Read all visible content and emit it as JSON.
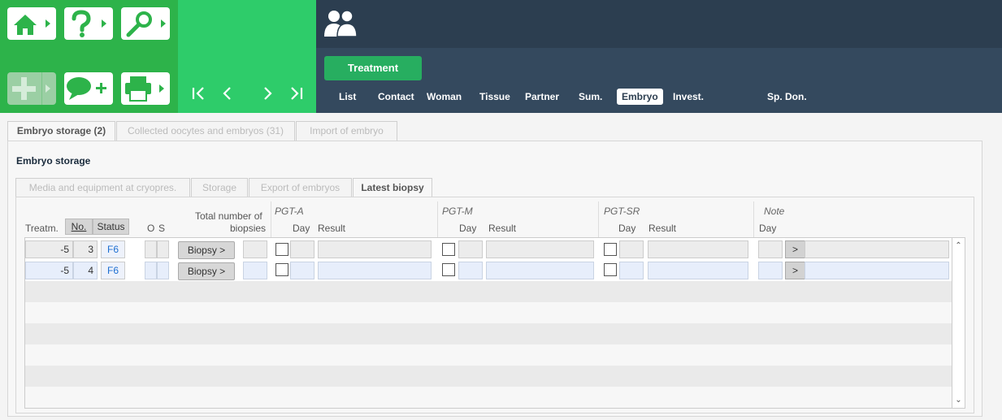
{
  "header": {
    "tools": [
      {
        "name": "home",
        "icon": "home-icon"
      },
      {
        "name": "help",
        "icon": "question-icon"
      },
      {
        "name": "search",
        "icon": "key-search-icon"
      },
      {
        "name": "add",
        "icon": "plus-icon"
      },
      {
        "name": "comment-add",
        "icon": "speech-bubble-plus-icon"
      },
      {
        "name": "print",
        "icon": "printer-icon"
      }
    ],
    "treatment_button": "Treatment",
    "nav_tabs": [
      {
        "label": "List"
      },
      {
        "label": "Contact"
      },
      {
        "label": "Woman"
      },
      {
        "label": "Tissue"
      },
      {
        "label": "Partner"
      },
      {
        "label": "Sum."
      },
      {
        "label": "Embryo",
        "active": true
      },
      {
        "label": "Invest."
      },
      {
        "label": "Sp. Don."
      }
    ]
  },
  "form_tabs": [
    {
      "label": "Embryo storage (2)",
      "active": true
    },
    {
      "label": "Collected oocytes and embryos (31)"
    },
    {
      "label": "Import of embryo"
    }
  ],
  "section_title": "Embryo storage",
  "sub_tabs": [
    {
      "label": "Media and equipment at cryopres."
    },
    {
      "label": "Storage"
    },
    {
      "label": "Export of embryos"
    },
    {
      "label": "Latest biopsy",
      "active": true
    }
  ],
  "columns": {
    "treatm": "Treatm.",
    "no": "No.",
    "status": "Status",
    "o": "O",
    "s": "S",
    "total_line1": "Total number of",
    "total_line2": "biopsies",
    "pgt_a": "PGT-A",
    "pgt_m": "PGT-M",
    "pgt_sr": "PGT-SR",
    "note": "Note",
    "day": "Day",
    "result": "Result"
  },
  "rows": [
    {
      "treatm": "-5",
      "no": "3",
      "status": "F6",
      "biopsy_button": "Biopsy >",
      "note_button": ">"
    },
    {
      "treatm": "-5",
      "no": "4",
      "status": "F6",
      "biopsy_button": "Biopsy >",
      "note_button": ">"
    }
  ],
  "colors": {
    "tools_bg": "#2db34a",
    "pager_bg": "#2ecc6a",
    "nav_dark": "#2c3e50",
    "nav_mid": "#34495e",
    "treatment_btn": "#27ae60",
    "status_text": "#1d6fd1"
  }
}
